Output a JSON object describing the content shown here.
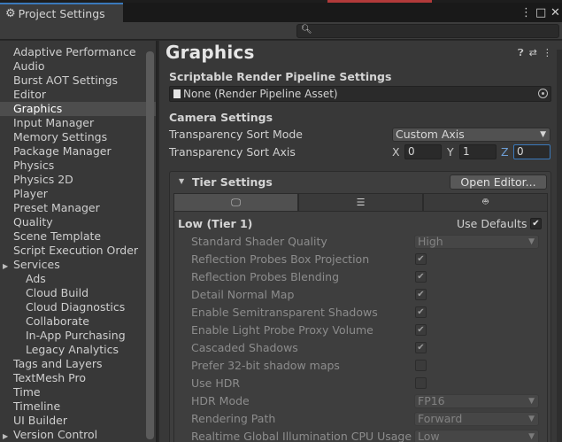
{
  "window": {
    "tab_title": "Project Settings",
    "tab_icon": "gear-icon",
    "buttons": [
      "⋮",
      "□",
      "✕"
    ],
    "search": {
      "placeholder": "",
      "value": ""
    }
  },
  "sidebar": {
    "items": [
      {
        "label": "Adaptive Performance",
        "kind": "item"
      },
      {
        "label": "Audio",
        "kind": "item"
      },
      {
        "label": "Burst AOT Settings",
        "kind": "item"
      },
      {
        "label": "Editor",
        "kind": "item"
      },
      {
        "label": "Graphics",
        "kind": "item",
        "selected": true
      },
      {
        "label": "Input Manager",
        "kind": "item"
      },
      {
        "label": "Memory Settings",
        "kind": "item"
      },
      {
        "label": "Package Manager",
        "kind": "item"
      },
      {
        "label": "Physics",
        "kind": "item"
      },
      {
        "label": "Physics 2D",
        "kind": "item"
      },
      {
        "label": "Player",
        "kind": "item"
      },
      {
        "label": "Preset Manager",
        "kind": "item"
      },
      {
        "label": "Quality",
        "kind": "item"
      },
      {
        "label": "Scene Template",
        "kind": "item"
      },
      {
        "label": "Script Execution Order",
        "kind": "item"
      },
      {
        "label": "Services",
        "kind": "group"
      },
      {
        "label": "Ads",
        "kind": "sub"
      },
      {
        "label": "Cloud Build",
        "kind": "sub"
      },
      {
        "label": "Cloud Diagnostics",
        "kind": "sub"
      },
      {
        "label": "Collaborate",
        "kind": "sub"
      },
      {
        "label": "In-App Purchasing",
        "kind": "sub"
      },
      {
        "label": "Legacy Analytics",
        "kind": "sub"
      },
      {
        "label": "Tags and Layers",
        "kind": "item"
      },
      {
        "label": "TextMesh Pro",
        "kind": "item"
      },
      {
        "label": "Time",
        "kind": "item"
      },
      {
        "label": "Timeline",
        "kind": "item"
      },
      {
        "label": "UI Builder",
        "kind": "item"
      },
      {
        "label": "Version Control",
        "kind": "group"
      }
    ]
  },
  "main": {
    "title": "Graphics",
    "srp": {
      "label": "Scriptable Render Pipeline Settings",
      "value": "None (Render Pipeline Asset)"
    },
    "camera": {
      "label": "Camera Settings",
      "sort_mode_label": "Transparency Sort Mode",
      "sort_mode_value": "Custom Axis",
      "sort_axis_label": "Transparency Sort Axis",
      "axis": {
        "x_label": "X",
        "x": "0",
        "y_label": "Y",
        "y": "1",
        "z_label": "Z",
        "z": "0"
      }
    },
    "tier": {
      "label": "Tier Settings",
      "open_editor": "Open Editor...",
      "tier_name": "Low (Tier 1)",
      "use_defaults_label": "Use Defaults",
      "use_defaults": true,
      "rows": [
        {
          "label": "Standard Shader Quality",
          "type": "dropdown",
          "value": "High"
        },
        {
          "label": "Reflection Probes Box Projection",
          "type": "check",
          "checked": true
        },
        {
          "label": "Reflection Probes Blending",
          "type": "check",
          "checked": true
        },
        {
          "label": "Detail Normal Map",
          "type": "check",
          "checked": true
        },
        {
          "label": "Enable Semitransparent Shadows",
          "type": "check",
          "checked": true
        },
        {
          "label": "Enable Light Probe Proxy Volume",
          "type": "check",
          "checked": true
        },
        {
          "label": "Cascaded Shadows",
          "type": "check",
          "checked": true
        },
        {
          "label": "Prefer 32-bit shadow maps",
          "type": "check",
          "checked": false
        },
        {
          "label": "Use HDR",
          "type": "check",
          "checked": false
        },
        {
          "label": "HDR Mode",
          "type": "dropdown",
          "value": "FP16"
        },
        {
          "label": "Rendering Path",
          "type": "dropdown",
          "value": "Forward"
        },
        {
          "label": "Realtime Global Illumination CPU Usage",
          "type": "dropdown",
          "value": "Low"
        }
      ]
    }
  }
}
